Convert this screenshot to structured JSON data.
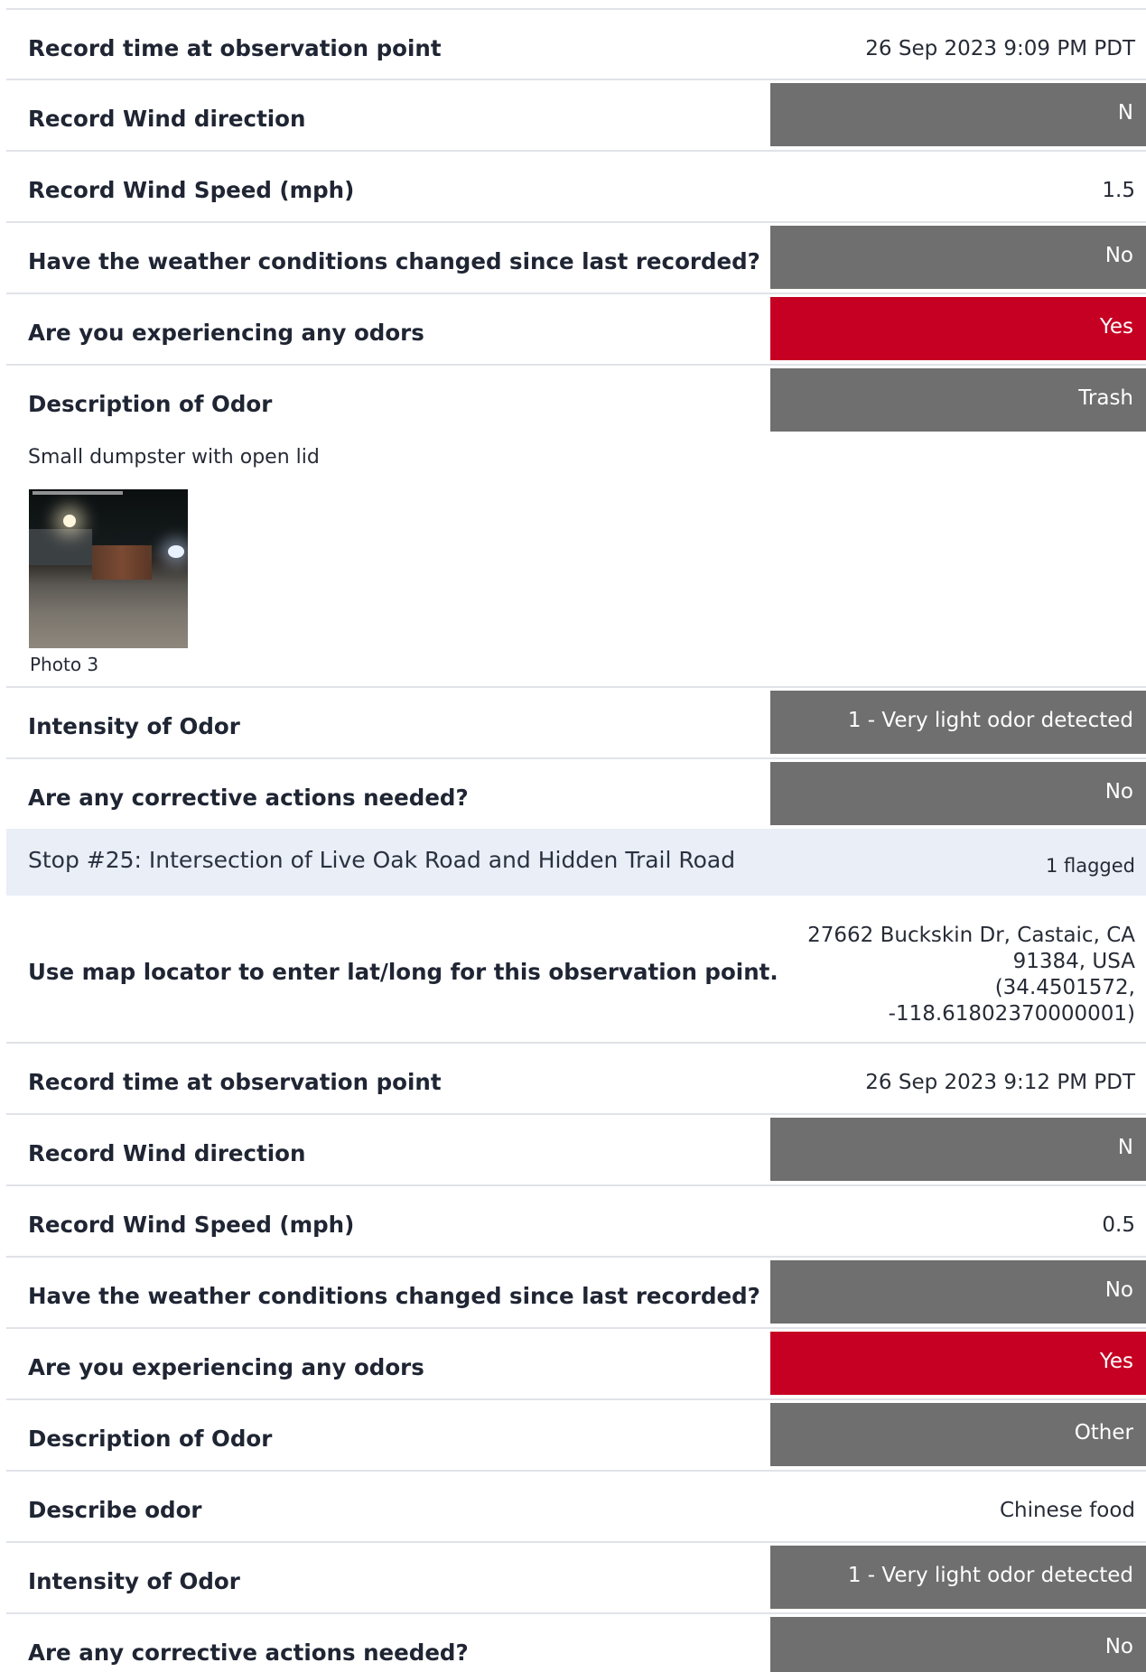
{
  "group1": {
    "record_time_label": "Record time at observation point",
    "record_time_value": "26 Sep 2023 9:09 PM PDT",
    "wind_dir_label": "Record Wind direction",
    "wind_dir_value": "N",
    "wind_speed_label": "Record Wind Speed (mph)",
    "wind_speed_value": "1.5",
    "weather_label": "Have the weather conditions changed since last recorded?",
    "weather_value": "No",
    "odors_label": "Are you experiencing any odors",
    "odors_value": "Yes",
    "desc_label": "Description of Odor",
    "desc_value": "Trash",
    "note": "Small dumpster with open lid",
    "photo_caption": "Photo 3",
    "intensity_label": "Intensity of Odor",
    "intensity_value": "1 - Very light odor detected",
    "corrective_label": "Are any corrective actions needed?",
    "corrective_value": "No"
  },
  "stop": {
    "title": "Stop #25: Intersection of Live Oak Road and Hidden Trail Road",
    "flagged": "1 flagged"
  },
  "group2": {
    "map_label": "Use map locator to enter lat/long for this observation point.",
    "address_line1": "27662 Buckskin Dr, Castaic, CA",
    "address_line2": "91384, USA",
    "address_line3": "(34.4501572,",
    "address_line4": "-118.61802370000001)",
    "record_time_label": "Record time at observation point",
    "record_time_value": "26 Sep 2023 9:12 PM PDT",
    "wind_dir_label": "Record Wind direction",
    "wind_dir_value": "N",
    "wind_speed_label": "Record Wind Speed (mph)",
    "wind_speed_value": "0.5",
    "weather_label": "Have the weather conditions changed since last recorded?",
    "weather_value": "No",
    "odors_label": "Are you experiencing any odors",
    "odors_value": "Yes",
    "desc_label": "Description of Odor",
    "desc_value": "Other",
    "describe_label": "Describe odor",
    "describe_value": "Chinese food",
    "intensity_label": "Intensity of Odor",
    "intensity_value": "1 - Very light odor detected",
    "corrective_label": "Are any corrective actions needed?",
    "corrective_value": "No"
  },
  "colors": {
    "neutral_pill": "#6f6f6f",
    "alert_pill": "#c60022",
    "stop_header_bg": "#e9eef7"
  }
}
